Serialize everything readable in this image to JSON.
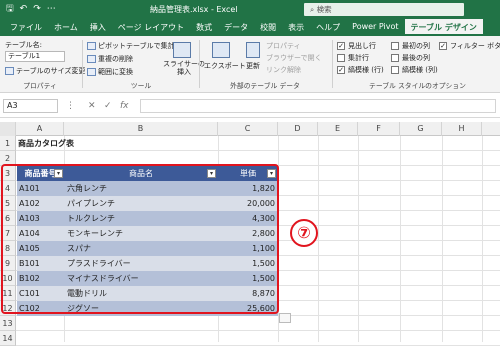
{
  "titlebar": {
    "title": "納品管理表.xlsx  -  Excel",
    "search_placeholder": "検索",
    "qat_save": "🖫",
    "qat_undo": "↶",
    "qat_redo": "↷",
    "qat_more": "⋯"
  },
  "tabs": [
    "ファイル",
    "ホーム",
    "挿入",
    "ページ レイアウト",
    "数式",
    "データ",
    "校閲",
    "表示",
    "ヘルプ",
    "Power Pivot",
    "テーブル デザイン"
  ],
  "ribbon": {
    "prop_label": "テーブル名:",
    "table_name": "テーブル1",
    "resize_label": "テーブルのサイズ変更",
    "prop_caption": "プロパティ",
    "pivot": "ピボットテーブルで集計",
    "remove_dup": "重複の削除",
    "convert": "範囲に変換",
    "slicer": "スライサーの\n挿入",
    "tools_caption": "ツール",
    "export": "エクスポート",
    "refresh": "更新",
    "properties": "プロパティ",
    "browser": "ブラウザーで開く",
    "unlink": "リンク解除",
    "ext_caption": "外部のテーブル データ",
    "opt_header": "見出し行",
    "opt_total": "集計行",
    "opt_banded": "縞模様 (行)",
    "opt_first": "最初の列",
    "opt_last": "最後の列",
    "opt_banded_col": "縞模様 (列)",
    "opt_filter": "フィルター ボタン",
    "style_caption": "テーブル スタイルのオプション"
  },
  "formula": {
    "namebox": "A3",
    "cancel": "✕",
    "enter": "✓",
    "fx": "fx",
    "value": ""
  },
  "columns": [
    "A",
    "B",
    "C",
    "D",
    "E",
    "F",
    "G",
    "H"
  ],
  "rows": [
    "1",
    "2",
    "3",
    "4",
    "5",
    "6",
    "7",
    "8",
    "9",
    "10",
    "11",
    "12",
    "13",
    "14"
  ],
  "sheet": {
    "title": "商品カタログ表",
    "headers": [
      "商品番号",
      "商品名",
      "単価"
    ],
    "items": [
      {
        "code": "A101",
        "name": "六角レンチ",
        "price": "1,820"
      },
      {
        "code": "A102",
        "name": "パイプレンチ",
        "price": "20,000"
      },
      {
        "code": "A103",
        "name": "トルクレンチ",
        "price": "4,300"
      },
      {
        "code": "A104",
        "name": "モンキーレンチ",
        "price": "2,800"
      },
      {
        "code": "A105",
        "name": "スパナ",
        "price": "1,100"
      },
      {
        "code": "B101",
        "name": "プラスドライバー",
        "price": "1,500"
      },
      {
        "code": "B102",
        "name": "マイナスドライバー",
        "price": "1,500"
      },
      {
        "code": "C101",
        "name": "電動ドリル",
        "price": "8,870"
      },
      {
        "code": "C102",
        "name": "ジグソー",
        "price": "25,600"
      }
    ]
  },
  "callout": "⑦",
  "colors": {
    "excel_green": "#217346",
    "table_header": "#3d5a98",
    "row_dark": "#b4c0d8",
    "row_light": "#d9dee8",
    "highlight": "#e1141e"
  }
}
